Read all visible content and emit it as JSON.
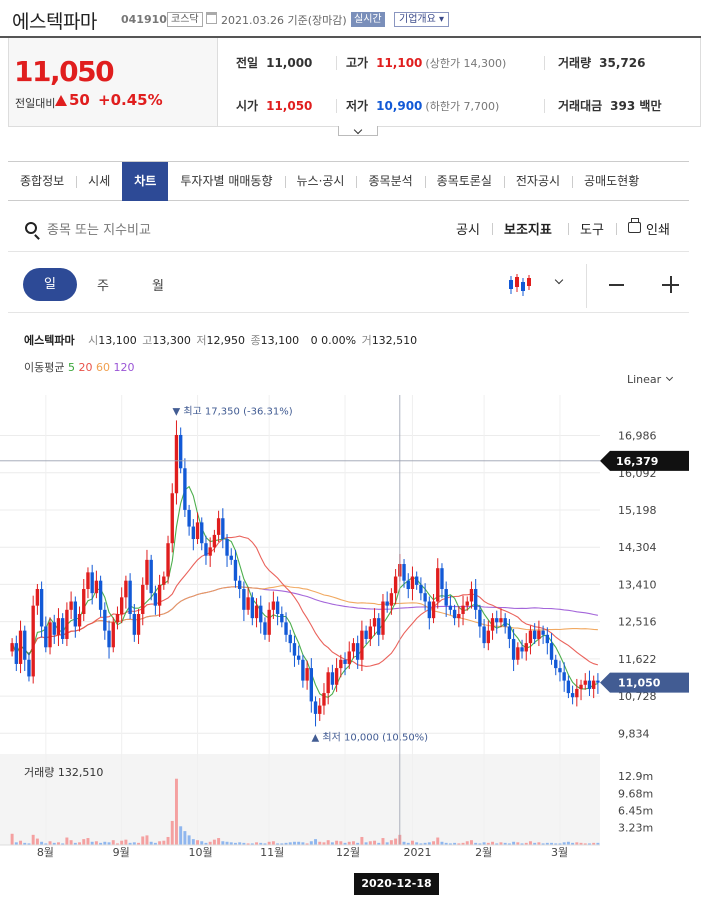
{
  "header": {
    "stock_name": "에스텍파마",
    "stock_code": "041910",
    "market": "코스닥",
    "date_text": "2021.03.26 기준(장마감)",
    "realtime_label": "실시간",
    "company_info_label": "기업개요 ▾"
  },
  "price": {
    "current": "11,050",
    "change_label": "전일대비",
    "change_value": "50",
    "change_pct": "+0.45%",
    "prev_close_label": "전일",
    "prev_close": "11,000",
    "high_label": "고가",
    "high": "11,100",
    "upper_limit": "(상한가 14,300)",
    "volume_label": "거래량",
    "volume": "35,726",
    "open_label": "시가",
    "open": "11,050",
    "low_label": "저가",
    "low": "10,900",
    "lower_limit": "(하한가 7,700)",
    "amount_label": "거래대금",
    "amount": "393 백만"
  },
  "tabs": [
    "종합정보",
    "시세",
    "차트",
    "투자자별 매매동향",
    "뉴스·공시",
    "종목분석",
    "종목토론실",
    "전자공시",
    "공매도현황"
  ],
  "active_tab": "차트",
  "toolbar": {
    "search_placeholder": "종목 또는 지수비교",
    "disclosure": "공시",
    "indicators": "보조지표",
    "tools": "도구",
    "print": "인쇄"
  },
  "periods": [
    "일",
    "주",
    "월"
  ],
  "chart_info": {
    "name": "에스텍파마",
    "open_label": "시",
    "open": "13,100",
    "high_label": "고",
    "high": "13,300",
    "low_label": "저",
    "low": "12,950",
    "close_label": "종",
    "close": "13,100",
    "change": "0",
    "change_pct": "0.00%",
    "volume_label": "거",
    "volume": "132,510"
  },
  "moving_average": {
    "label": "이동평균",
    "periods": [
      {
        "value": "5",
        "color": "#3aa63a"
      },
      {
        "value": "20",
        "color": "#e8524a"
      },
      {
        "value": "60",
        "color": "#f0a050"
      },
      {
        "value": "120",
        "color": "#9a55d6"
      }
    ]
  },
  "scale_label": "Linear",
  "colors": {
    "up": "#e01e1e",
    "down": "#1259d6",
    "navy": "#2d4a96",
    "label_bg": "#425c93"
  },
  "chart_data": {
    "type": "candlestick",
    "y_ticks": [
      "16,986",
      "16,092",
      "15,198",
      "14,304",
      "13,410",
      "12,516",
      "11,622",
      "10,728",
      "9,834"
    ],
    "y_tick_values": [
      16986,
      16092,
      15198,
      14304,
      13410,
      12516,
      11622,
      10728,
      9834
    ],
    "ylim": [
      9385,
      17960
    ],
    "x_labels": [
      "8월",
      "9월",
      "10월",
      "11월",
      "12월",
      "2021",
      "2월",
      "3월"
    ],
    "crosshair_price": "16,379",
    "crosshair_date": "2020-12-18",
    "last_price_label": "11,050",
    "max_annotation": "최고 17,350 (-36.31%)",
    "min_annotation": "최저 10,000 (10.50%)",
    "volume_title": "거래량 132,510",
    "volume_ticks": [
      "12.9m",
      "9.68m",
      "6.45m",
      "3.23m"
    ],
    "closes": [
      12000,
      11500,
      12300,
      11600,
      11200,
      12900,
      13300,
      12400,
      11900,
      12500,
      12200,
      12600,
      12100,
      12800,
      13000,
      12400,
      12700,
      13300,
      13700,
      13200,
      13500,
      12800,
      12300,
      11900,
      12500,
      12700,
      13100,
      13500,
      12700,
      12200,
      12700,
      13400,
      14000,
      13200,
      12900,
      13400,
      13600,
      14400,
      15600,
      17000,
      16200,
      15200,
      14800,
      14500,
      14900,
      14400,
      14100,
      14300,
      14600,
      15000,
      14500,
      14100,
      14000,
      13500,
      13300,
      12800,
      13100,
      12600,
      12900,
      12500,
      12200,
      12800,
      13000,
      12700,
      12500,
      12200,
      12000,
      11700,
      11600,
      11100,
      11400,
      10600,
      10300,
      10500,
      10800,
      11300,
      11000,
      11400,
      11600,
      11500,
      11800,
      12000,
      11600,
      12300,
      12100,
      12400,
      12600,
      12200,
      13000,
      12900,
      13200,
      13600,
      13900,
      13500,
      13300,
      13600,
      13400,
      13200,
      13000,
      12600,
      13000,
      13800,
      13300,
      12900,
      12800,
      12600,
      12700,
      12900,
      13000,
      13300,
      12800,
      12400,
      12000,
      12300,
      12600,
      12500,
      12600,
      12400,
      12100,
      11600,
      11900,
      11800,
      12000,
      12300,
      12100,
      12300,
      12200,
      12000,
      11600,
      11400,
      11300,
      11100,
      10800,
      10700,
      10900,
      11000,
      11100,
      10900,
      11100,
      11050
    ],
    "volumes": [
      2.1,
      0.5,
      0.8,
      0.4,
      0.3,
      1.9,
      1.2,
      0.6,
      0.3,
      0.7,
      0.4,
      0.5,
      0.3,
      1.4,
      0.9,
      0.4,
      0.5,
      1.1,
      1.3,
      0.6,
      0.7,
      0.4,
      0.6,
      0.5,
      0.9,
      0.3,
      0.8,
      1.0,
      0.4,
      0.5,
      0.4,
      1.6,
      1.8,
      0.6,
      0.4,
      0.7,
      0.8,
      1.5,
      4.5,
      12.4,
      3.5,
      2.6,
      1.8,
      1.1,
      0.9,
      0.7,
      0.4,
      0.6,
      1.0,
      1.3,
      0.7,
      0.6,
      0.5,
      0.4,
      0.5,
      0.4,
      0.3,
      0.3,
      0.5,
      0.4,
      0.3,
      0.6,
      0.7,
      0.3,
      0.3,
      0.4,
      0.5,
      0.6,
      0.6,
      0.5,
      0.3,
      0.7,
      1.1,
      0.6,
      0.5,
      0.9,
      0.5,
      0.8,
      0.7,
      0.4,
      0.6,
      0.7,
      0.4,
      1.5,
      0.5,
      0.7,
      0.8,
      0.4,
      1.3,
      0.5,
      0.9,
      1.2,
      1.9,
      0.6,
      0.4,
      0.8,
      0.5,
      0.3,
      0.4,
      0.5,
      0.7,
      1.4,
      0.6,
      0.4,
      0.3,
      0.4,
      0.3,
      0.4,
      0.7,
      0.9,
      0.4,
      0.3,
      0.5,
      0.4,
      0.6,
      0.3,
      0.5,
      0.4,
      0.3,
      0.6,
      0.5,
      0.3,
      0.4,
      0.7,
      0.4,
      0.5,
      0.3,
      0.4,
      0.4,
      0.3,
      0.3,
      0.5,
      0.6,
      0.4,
      0.5,
      0.4,
      0.3,
      0.3,
      0.4,
      0.4
    ]
  }
}
